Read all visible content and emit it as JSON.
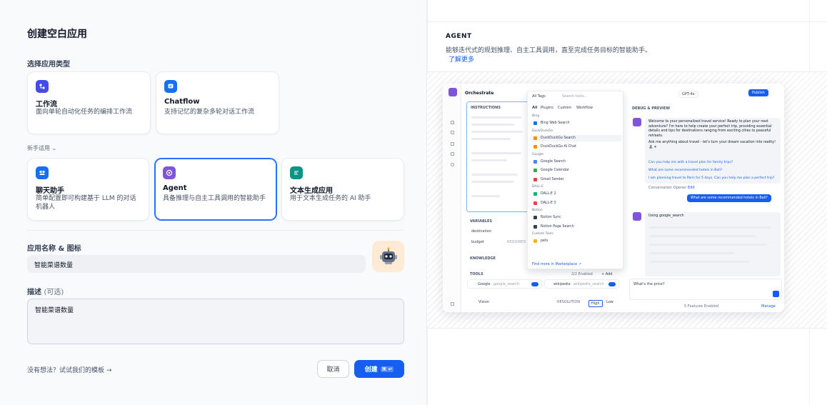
{
  "left": {
    "title": "创建空白应用",
    "type_label": "选择应用类型",
    "cards_top": [
      {
        "title": "工作流",
        "desc": "面向单轮自动化任务的编排工作流",
        "color": "#444ce7",
        "icon": "workflow-icon"
      },
      {
        "title": "Chatflow",
        "desc": "支持记忆的复杂多轮对话工作流",
        "color": "#1570ef",
        "icon": "chatflow-icon"
      }
    ],
    "new_label": "新手适用",
    "cards_bottom": [
      {
        "title": "聊天助手",
        "desc": "简单配置即可构建基于 LLM 的对话机器人",
        "color": "#1570ef",
        "icon": "chat-icon"
      },
      {
        "title": "Agent",
        "desc": "具备推理与自主工具调用的智能助手",
        "color": "#7f56d9",
        "icon": "agent-icon"
      },
      {
        "title": "文本生成应用",
        "desc": "用于文本生成任务的 AI 助手",
        "color": "#0e9384",
        "icon": "text-gen-icon"
      }
    ],
    "name_label": "应用名称 & 图标",
    "name_value": "智能菜谱数量",
    "desc_label": "描述",
    "desc_optional": "(可选)",
    "desc_value": "智能菜谱数量",
    "template_link": "没有想法？试试我们的模板 →",
    "cancel": "取消",
    "create": "创建",
    "create_kbd": "⌘ ↵"
  },
  "right": {
    "heading": "AGENT",
    "desc": "能够迭代式的规划推理、自主工具调用，直至完成任务目标的智能助手。",
    "learn_more": "了解更多",
    "preview": {
      "orchestrate": "Orchestrate",
      "instructions": "INSTRUCTIONS",
      "variables": "VARIABLES",
      "var1": "destination",
      "var2": "budget",
      "required": "REQUIRED",
      "knowledge": "KNOWLEDGE",
      "tools": "TOOLS",
      "tools_enabled": "2/2 Enabled",
      "add": "+ Add",
      "tool1": "Google",
      "tool1_sub": "google_search",
      "tool2": "wikipedia",
      "tool2_sub": "wikipedia_search",
      "vision": "Vision",
      "resolution": "RESOLUTION",
      "high": "High",
      "low": "Low",
      "dd_all_tags": "All Tags",
      "dd_search": "Search tools...",
      "dd_tabs": [
        "All",
        "Plugins",
        "Custom",
        "Workflow"
      ],
      "dd_rows": [
        {
          "cat": "Bing"
        },
        {
          "label": "Bing Web Search",
          "color": "#1570ef"
        },
        {
          "cat": "DuckDuckGo"
        },
        {
          "label": "DuckDuckGo Search",
          "color": "#f79009",
          "hl": true
        },
        {
          "label": "DuckDuckGo AI Chat",
          "color": "#f79009"
        },
        {
          "cat": "Google"
        },
        {
          "label": "Google Search",
          "color": "#4285f4"
        },
        {
          "label": "Google Calendar",
          "color": "#34a853"
        },
        {
          "label": "Gmail Sender",
          "color": "#ea4335"
        },
        {
          "cat": "DALL-E"
        },
        {
          "label": "DALL-E 2",
          "color": "#12b76a"
        },
        {
          "label": "DALL-E 3",
          "color": "#f04438"
        },
        {
          "cat": "Notion"
        },
        {
          "label": "Notion Sync",
          "color": "#344054"
        },
        {
          "label": "Notion Page Search",
          "color": "#344054"
        },
        {
          "cat": "Custom Tools"
        },
        {
          "label": "pets",
          "color": "#fdb022"
        }
      ],
      "dd_footer": "Find more in Marketplace ↗",
      "model": "GPT-4o",
      "publish": "Publish",
      "debug": "DEBUG & PREVIEW",
      "welcome": "Welcome to your personalized travel service! Ready to plan your next adventure? I'm here to help create your perfect trip, providing essential details and tips for destinations ranging from exciting cities to peaceful retreats.",
      "ask": "Ask me anything about travel - let's turn your dream vacation into reality! 🏝 ✈",
      "q1": "Can you help me with a travel plan for family trips?",
      "q2": "What are some recommended hotels in Bali?",
      "q3": "I am planning travel to Paris for 5 days. Can you help me plan a perfect trip?",
      "opener": "Conversation Opener",
      "edit": "Edit",
      "user_msg": "What are some recommended hotels in Bali?",
      "using": "Using",
      "using_tool": "google_search",
      "input_placeholder": "What's the price?",
      "features": "5 Features Enabled",
      "manage": "Manage"
    }
  }
}
